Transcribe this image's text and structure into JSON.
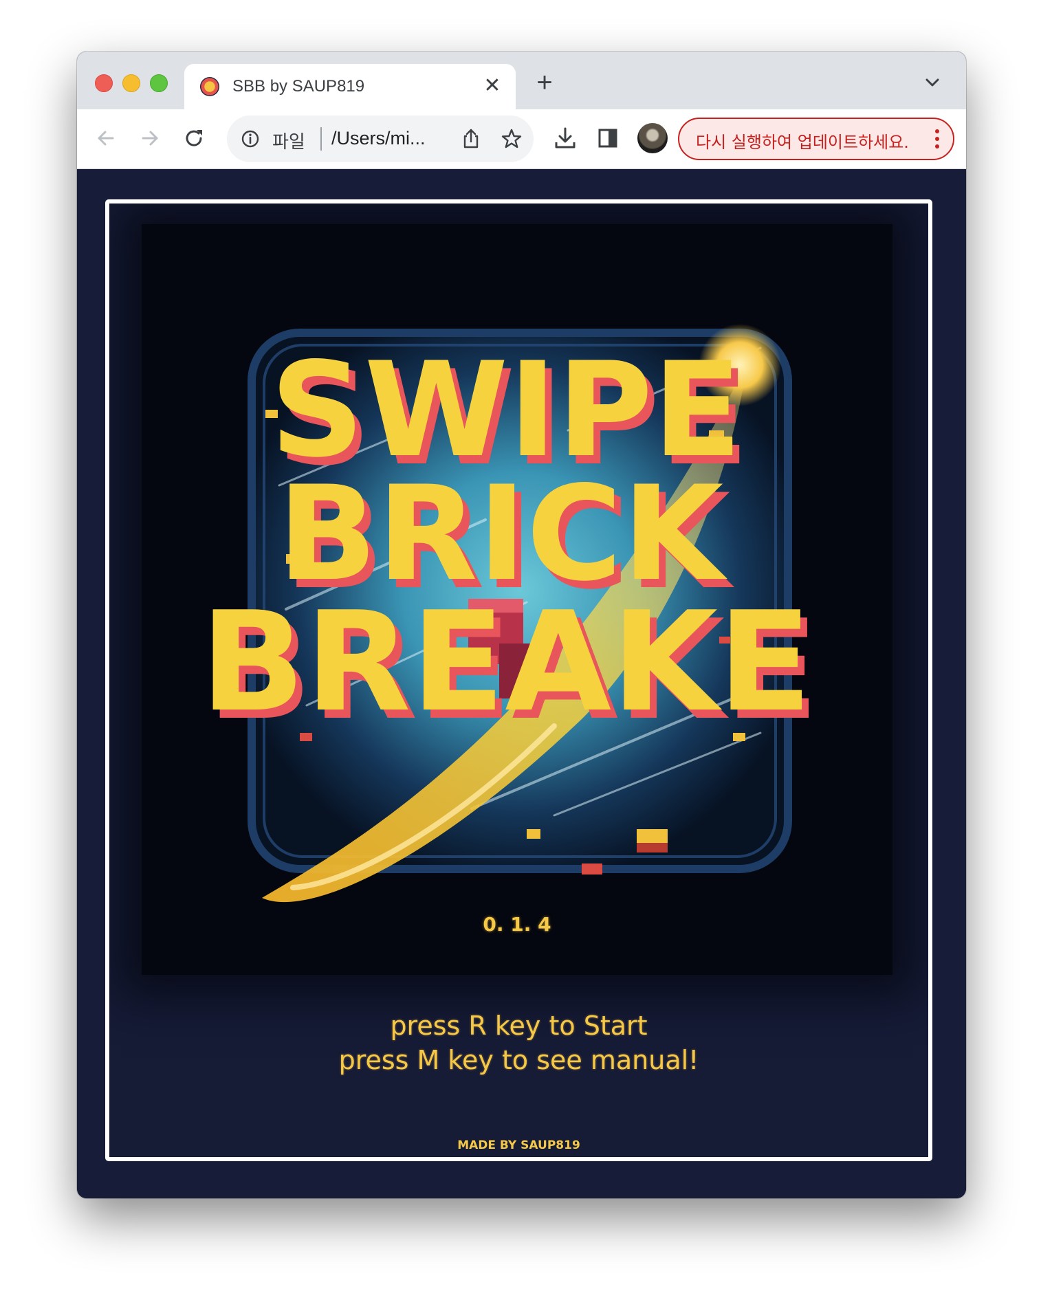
{
  "browser": {
    "tab": {
      "title": "SBB by SAUP819",
      "close_glyph": "✕",
      "favicon": "game-favicon"
    },
    "new_tab_glyph": "+",
    "toolbar": {
      "back_icon": "back-arrow-icon",
      "forward_icon": "forward-arrow-icon",
      "reload_icon": "reload-icon",
      "omnibox": {
        "scheme_label": "파일",
        "url": "/Users/mi..."
      },
      "update_button_label": "다시 실행하여 업데이트하세요."
    }
  },
  "game": {
    "title_lines": [
      "SWIPE",
      "BRICK",
      "BREAKE"
    ],
    "version": "0. 1. 4",
    "start_prompt": "press R key to Start",
    "manual_prompt": "press M key to see manual!",
    "credit": "MADE BY SAUP819"
  },
  "colors": {
    "page_background": "#171c39",
    "title_yellow": "#f7d23f",
    "title_shadow_red": "#e8555a",
    "prompt_yellow": "#f5c947",
    "frame_border": "#ffffff",
    "update_red": "#c5221f"
  }
}
